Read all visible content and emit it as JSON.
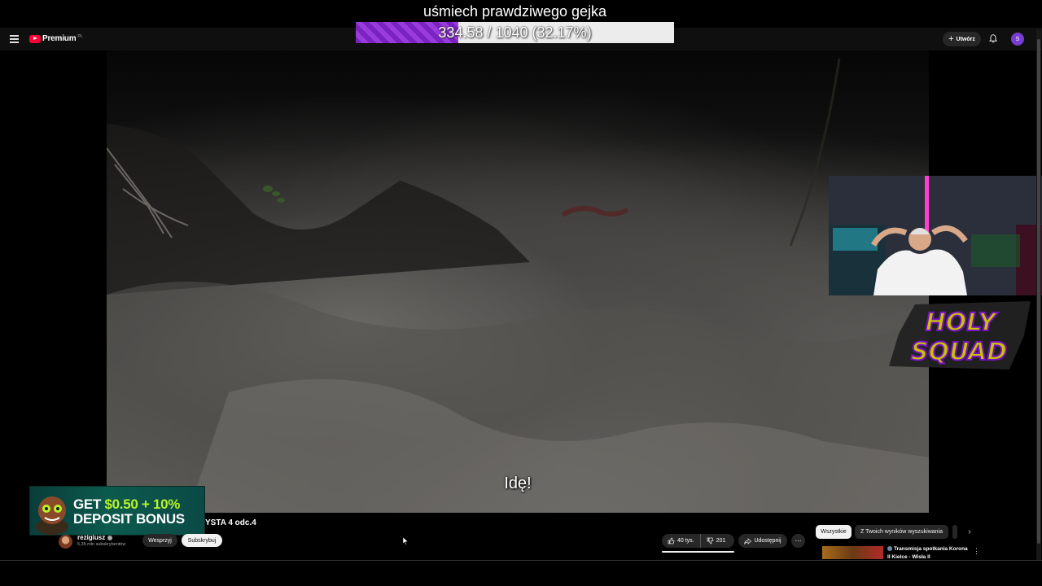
{
  "header": {
    "logo_text": "Premium",
    "logo_region": "PL",
    "create_label": "Utwórz",
    "avatar_letter": "S"
  },
  "overlay": {
    "goal_title": "uśmiech prawdziwego gejka",
    "goal_progress_text": "334.58 / 1040 (32.17%)",
    "goal_fraction": 0.3217,
    "holy_squad_logo_text": "HOLY SQUAD"
  },
  "video": {
    "subtitle": "Idę!",
    "title_visible": "YSTA 4 odc.4"
  },
  "ad": {
    "line1_prefix": "GET ",
    "line1_accent": "$0.50 + 10%",
    "line2": "DEPOSIT BONUS"
  },
  "channel": {
    "name": "rezigiusz",
    "subscribers": "5,35 mln subskrybentów",
    "support_label": "Wesprzyj",
    "subscribe_label": "Subskrybuj"
  },
  "actions": {
    "likes": "40 tys.",
    "dislikes": "201",
    "share_label": "Udostępnij",
    "more_label": "⋯"
  },
  "recommendations": {
    "chips": [
      "Wszystkie",
      "Z Twoich wyników wyszukiwania"
    ],
    "items": [
      {
        "title": "Transmisja spotkania Korona II Kielce - Wisła II"
      }
    ]
  },
  "colors": {
    "goal_fill": "#7b22c2",
    "holy_squad": "#c9c400",
    "youtube_red": "#ff0033",
    "ad_accent": "#b9f22b"
  }
}
